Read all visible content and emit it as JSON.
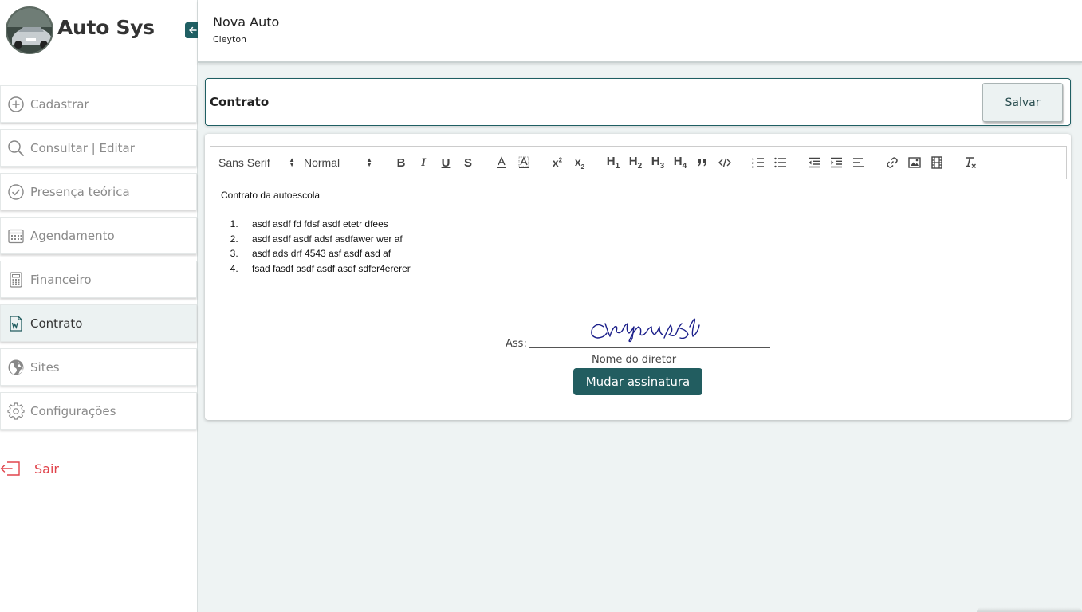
{
  "brand": {
    "title": "Auto Sys"
  },
  "header": {
    "school_name": "Nova Auto",
    "user_name": "Cleyton"
  },
  "sidebar": {
    "items": [
      {
        "label": "Cadastrar",
        "icon": "plus-circle-icon"
      },
      {
        "label": "Consultar | Editar",
        "icon": "search-icon"
      },
      {
        "label": "Presença teórica",
        "icon": "check-circle-icon"
      },
      {
        "label": "Agendamento",
        "icon": "calendar-icon"
      },
      {
        "label": "Financeiro",
        "icon": "calculator-icon"
      },
      {
        "label": "Contrato",
        "icon": "word-document-icon",
        "active": true
      },
      {
        "label": "Sites",
        "icon": "globe-icon"
      },
      {
        "label": "Configurações",
        "icon": "gear-icon"
      }
    ],
    "logout_label": "Sair"
  },
  "contract": {
    "title": "Contrato",
    "save_label": "Salvar"
  },
  "toolbar": {
    "font_value": "Sans Serif",
    "size_value": "Normal",
    "h1": "H",
    "h2": "H",
    "h3": "H",
    "h4": "H",
    "h1n": "1",
    "h2n": "2",
    "h3n": "3",
    "h4n": "4"
  },
  "document": {
    "intro": "Contrato da autoescola",
    "items": [
      "asdf asdf fd fdsf asdf etetr dfees",
      "asdf asdf asdf adsf asdfawer wer af",
      "asdf ads drf 4543 asf asdf asd af",
      "fsad fasdf asdf asdf asdf sdfer4ererer"
    ]
  },
  "signature": {
    "ass_label": "Ass:",
    "director_label": "Nome do diretor",
    "change_label": "Mudar assinatura"
  },
  "colors": {
    "accent": "#225d60",
    "logout": "#e0434b",
    "background": "#eef3f3"
  }
}
